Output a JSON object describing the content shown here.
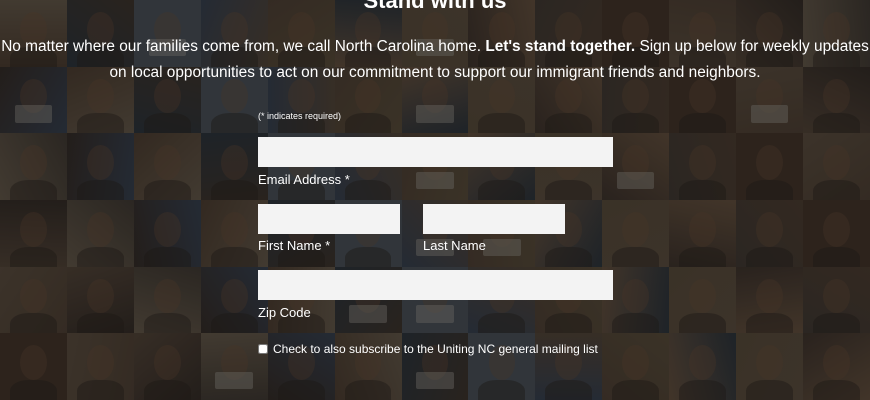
{
  "headline": "Stand with us",
  "intro": {
    "lead": "No matter where our families come from, we call North Carolina home. ",
    "emphasis": "Let's stand together.",
    "rest": " Sign up below for weekly updates on local opportunities to act on our commitment to support our immigrant friends and neighbors."
  },
  "form": {
    "required_note": "(* indicates required)",
    "email": {
      "label": "Email Address *",
      "value": ""
    },
    "first_name": {
      "label": "First Name *",
      "value": ""
    },
    "last_name": {
      "label": "Last Name",
      "value": ""
    },
    "zip": {
      "label": "Zip Code",
      "value": ""
    },
    "subscribe": {
      "label": "Check to also subscribe to the Uniting NC general mailing list",
      "checked": false
    }
  },
  "colors": {
    "text": "#ffffff",
    "field_bg": "#f3f3f3",
    "overlay": "rgba(0,0,0,0.52)"
  }
}
